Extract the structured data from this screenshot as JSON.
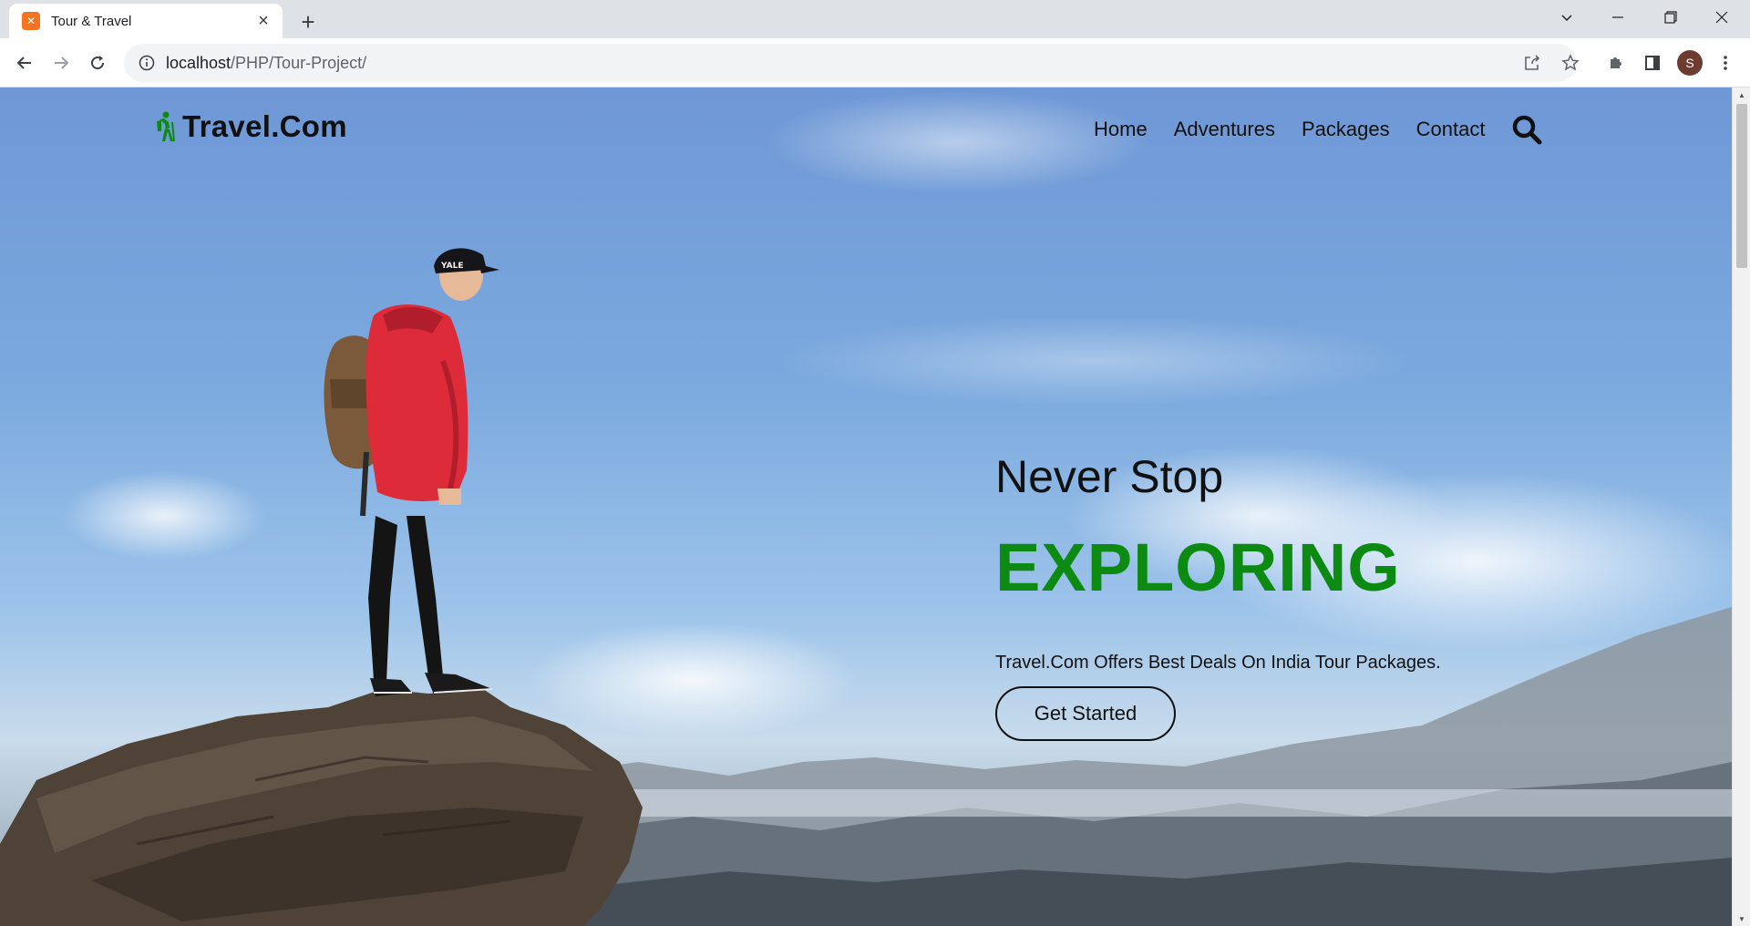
{
  "browser": {
    "tab": {
      "title": "Tour & Travel",
      "favicon_icon": "xampp-icon"
    },
    "url": {
      "host": "localhost",
      "path": "/PHP/Tour-Project/"
    },
    "profile_initial": "S"
  },
  "site": {
    "logo": {
      "text": "Travel.Com",
      "icon": "hiker-icon",
      "icon_color": "#0d8a12"
    },
    "nav": {
      "items": [
        "Home",
        "Adventures",
        "Packages",
        "Contact"
      ],
      "search_icon": "search-icon"
    },
    "hero": {
      "pretitle": "Never Stop",
      "title": "EXPLORING",
      "description": "Travel.Com Offers Best Deals On India Tour Packages.",
      "cta_label": "Get Started",
      "accent_color": "#0d8a12"
    }
  }
}
